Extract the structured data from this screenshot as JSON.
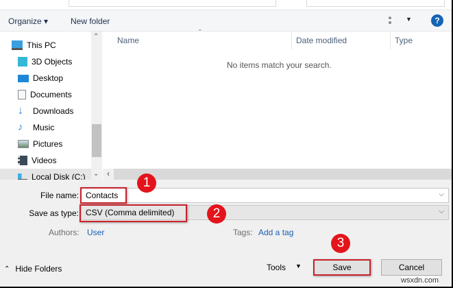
{
  "toolbar": {
    "organize": "Organize ▾",
    "new_folder": "New folder",
    "view_icon": "view-details-icon",
    "help": "?"
  },
  "nav": {
    "items": [
      {
        "label": "This PC",
        "icon": "computer-icon"
      },
      {
        "label": "3D Objects",
        "icon": "cube-icon"
      },
      {
        "label": "Desktop",
        "icon": "desktop-icon"
      },
      {
        "label": "Documents",
        "icon": "document-icon"
      },
      {
        "label": "Downloads",
        "icon": "download-icon"
      },
      {
        "label": "Music",
        "icon": "music-icon"
      },
      {
        "label": "Pictures",
        "icon": "pictures-icon"
      },
      {
        "label": "Videos",
        "icon": "videos-icon"
      },
      {
        "label": "Local Disk (C:)",
        "icon": "drive-icon"
      }
    ]
  },
  "columns": {
    "name": "Name",
    "date": "Date modified",
    "type": "Type"
  },
  "empty_message": "No items match your search.",
  "form": {
    "file_name_label": "File name:",
    "file_name": "Contacts",
    "type_label": "Save as type:",
    "type_value": "CSV (Comma delimited)",
    "authors_label": "Authors:",
    "authors": "User",
    "tags_label": "Tags:",
    "tags": "Add a tag"
  },
  "footer": {
    "hide_folders": "Hide Folders",
    "tools": "Tools",
    "save": "Save",
    "cancel": "Cancel"
  },
  "annotations": [
    "1",
    "2",
    "3"
  ],
  "watermark": "wsxdn.com",
  "colors": {
    "annotation": "#e3141b",
    "link": "#1a5fb4"
  }
}
